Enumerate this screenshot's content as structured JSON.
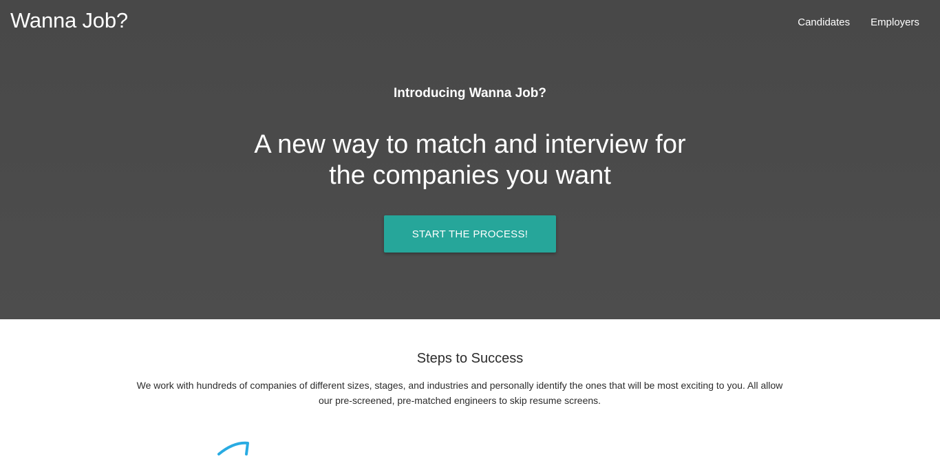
{
  "header": {
    "brand": "Wanna Job?",
    "nav": [
      {
        "label": "Candidates"
      },
      {
        "label": "Employers"
      }
    ]
  },
  "hero": {
    "intro": "Introducing Wanna Job?",
    "headline_line1": "A new way to match and interview for",
    "headline_line2": "the companies you want",
    "cta_label": "START THE PROCESS!"
  },
  "steps": {
    "title": "Steps to Success",
    "description_line1": "We work with hundreds of companies of different sizes, stages, and industries and personally identify the ones that will be most exciting to you. All allow",
    "description_line2": "our pre-screened, pre-matched engineers to skip resume screens."
  },
  "colors": {
    "hero_bg": "#4a4a4a",
    "cta_bg": "#26a69a",
    "icon_stroke": "#29abe2"
  },
  "icons": {
    "step_icon": "paper-plane-icon"
  }
}
